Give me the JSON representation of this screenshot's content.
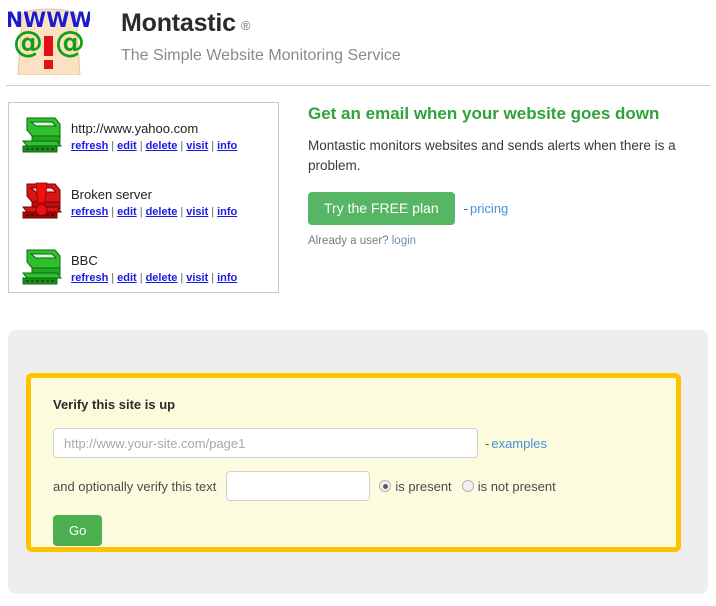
{
  "header": {
    "logo_icon": "montastic-face-logo",
    "logo_parts": {
      "hair_text": "NWWW",
      "eye_glyph": "@",
      "nose_glyph": "!"
    },
    "brand": "Montastic",
    "registered_mark": "®",
    "tagline": "The Simple Website Monitoring Service"
  },
  "sites": {
    "items": [
      {
        "name": "http://www.yahoo.com",
        "status": "up",
        "icon": "server-up-icon",
        "links": [
          "refresh",
          "edit",
          "delete",
          "visit",
          "info"
        ]
      },
      {
        "name": "Broken server",
        "status": "down",
        "icon": "server-down-icon",
        "links": [
          "refresh",
          "edit",
          "delete",
          "visit",
          "info"
        ]
      },
      {
        "name": "BBC",
        "status": "up",
        "icon": "server-up-icon",
        "links": [
          "refresh",
          "edit",
          "delete",
          "visit",
          "info"
        ]
      }
    ],
    "separator": "|"
  },
  "promo": {
    "heading": "Get an email when your website goes down",
    "body": "Montastic monitors websites and sends alerts when there is a problem.",
    "cta_label": "Try the FREE plan",
    "cta_dash": "-",
    "pricing_link": "pricing",
    "already_prefix": "Already a user?",
    "login_link": "login"
  },
  "verify": {
    "title": "Verify this site is up",
    "url_placeholder": "http://www.your-site.com/page1",
    "url_value": "",
    "examples_dash": "-",
    "examples_link": "examples",
    "optional_label": "and optionally verify this text",
    "text_value": "",
    "text_placeholder": "",
    "radio_options": [
      {
        "label": "is present",
        "selected": true
      },
      {
        "label": "is not present",
        "selected": false
      }
    ],
    "go_label": "Go"
  },
  "colors": {
    "brand_green": "#2fa23c",
    "button_green": "#56b664",
    "go_green": "#4caf50",
    "link_blue": "#1a1ae6",
    "soft_link_blue": "#4a90d9",
    "yellow_border": "#fdc300",
    "yellow_fill": "#fdfbdd",
    "panel_gray": "#eeeeee",
    "status_up": "#1fa81f",
    "status_down": "#e02020"
  }
}
